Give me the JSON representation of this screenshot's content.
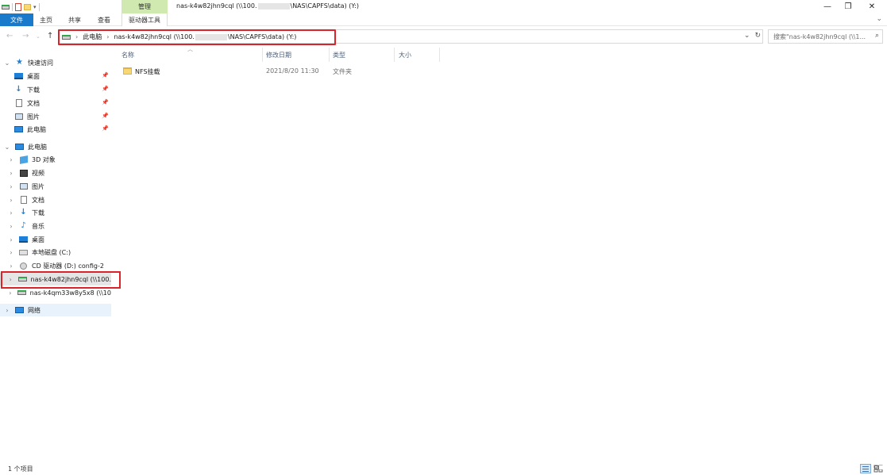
{
  "titlebar": {
    "manage_tab": "管理",
    "title_prefix": "nas-k4w82jhn9cql (\\\\100.",
    "title_suffix": "\\NAS\\CAPFS\\data) (Y:)",
    "minimize": "—",
    "restore": "❐",
    "close": "✕"
  },
  "ribbon": {
    "tabs": [
      "文件",
      "主页",
      "共享",
      "查看"
    ],
    "tool_tab": "驱动器工具",
    "collapse": "⌄"
  },
  "address": {
    "crumbs": [
      "此电脑",
      "nas-k4w82jhn9cql (\\\\100."
    ],
    "crumb_suffix": "\\NAS\\CAPFS\\data) (Y:)",
    "search_placeholder": "搜索\"nas-k4w82jhn9cql (\\\\1..."
  },
  "nav": {
    "quick_access": "快速访问",
    "quick_items": [
      "桌面",
      "下载",
      "文档",
      "图片",
      "此电脑"
    ],
    "this_pc": "此电脑",
    "pc_items": [
      "3D 对象",
      "视频",
      "图片",
      "文档",
      "下载",
      "音乐",
      "桌面",
      "本地磁盘 (C:)",
      "CD 驱动器 (D:) config-2",
      "nas-k4w82jhn9cql (\\\\100.",
      "nas-k4qm33w8y5x8 (\\\\10"
    ],
    "network": "网络"
  },
  "columns": {
    "name": "名称",
    "modified": "修改日期",
    "type": "类型",
    "size": "大小"
  },
  "files": [
    {
      "name": "NFS挂载",
      "modified": "2021/8/20 11:30",
      "type": "文件夹",
      "size": ""
    }
  ],
  "status": {
    "item_count": "1 个项目"
  },
  "colors": {
    "accent": "#1979ca",
    "highlight_box": "#d9252a",
    "manage_tab_bg": "#cfe9b0"
  }
}
